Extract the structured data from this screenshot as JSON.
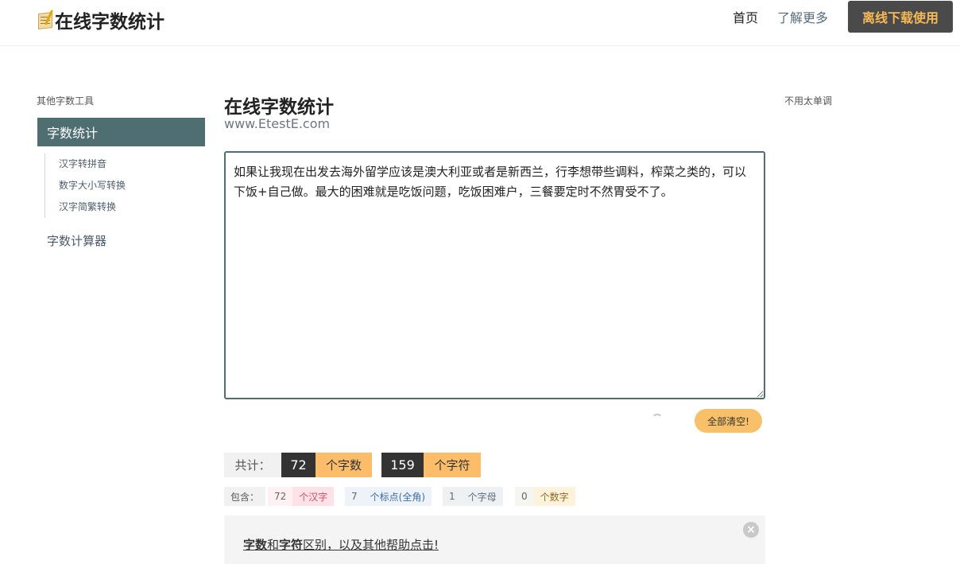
{
  "header": {
    "logo_text": "在线字数统计",
    "nav_home": "首页",
    "nav_more": "了解更多",
    "download": "离线下载使用"
  },
  "sidebar": {
    "title": "其他字数工具",
    "active": "字数统计",
    "sub_items": [
      "汉字转拼音",
      "数字大小写转换",
      "汉字简繁转换"
    ],
    "calculator": "字数计算器"
  },
  "main": {
    "title": "在线字数统计",
    "subtitle": "www.EtestE.com",
    "text": "如果让我现在出发去海外留学应该是澳大利亚或者是新西兰，行李想带些调料，榨菜之类的，可以下饭+自己做。最大的困难就是吃饭问题，吃饭困难户，三餐要定时不然胃受不了。",
    "clear_button": "全部清空!"
  },
  "stats": {
    "total_label": "共计：",
    "word_count": "72",
    "word_label": "个字数",
    "char_count": "159",
    "char_label": "个字符",
    "breakdown_label": "包含：",
    "han_count": "72",
    "han_label": "个汉字",
    "punct_count": "7",
    "punct_label": "个标点(全角)",
    "letter_count": "1",
    "letter_label": "个字母",
    "digit_count": "0",
    "digit_label": "个数字"
  },
  "help": {
    "part1": "字数",
    "part2": "和",
    "part3": "字符",
    "part4": "区别，以及其他帮助点击!",
    "close": "×"
  },
  "right": {
    "text": "不用太单调"
  },
  "colors": {
    "accent": "#4e6e72",
    "orange": "#fbbd6a",
    "dark": "#333333"
  }
}
